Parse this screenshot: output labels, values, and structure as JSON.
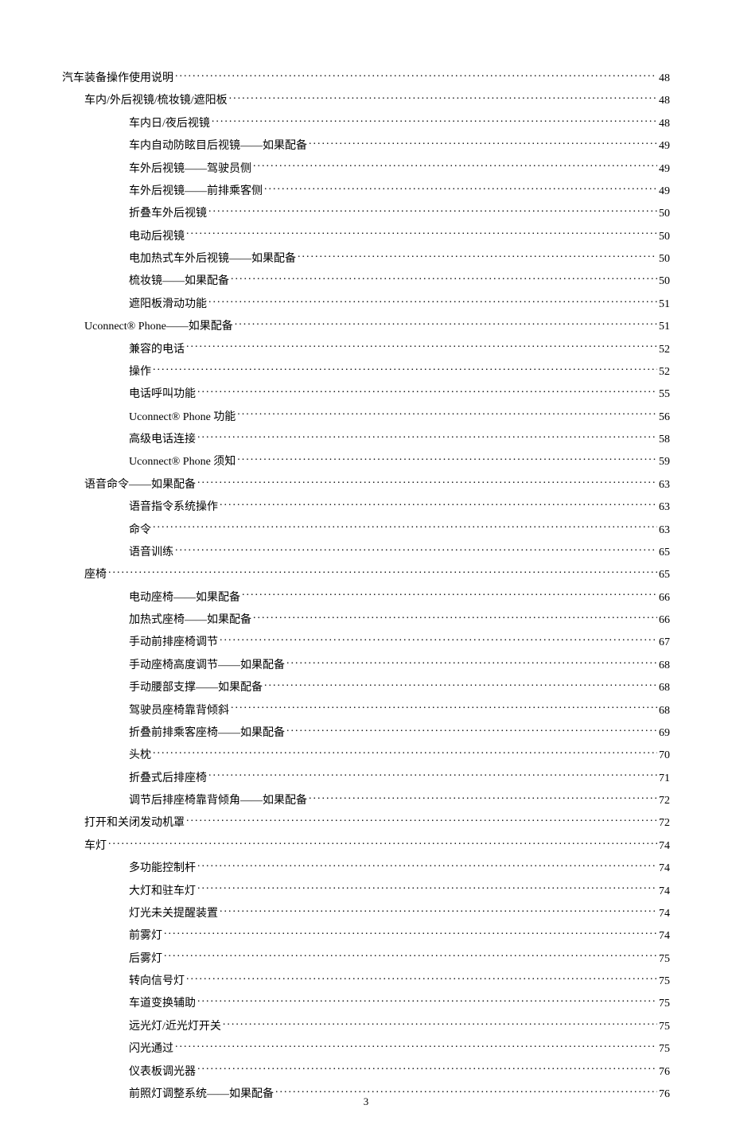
{
  "page_number": "3",
  "toc": [
    {
      "level": 0,
      "title": "汽车装备操作使用说明",
      "page": "48"
    },
    {
      "level": 1,
      "title": "车内/外后视镜/梳妆镜/遮阳板",
      "page": "48"
    },
    {
      "level": 2,
      "title": "车内日/夜后视镜",
      "page": "48"
    },
    {
      "level": 2,
      "title": "车内自动防眩目后视镜——如果配备",
      "page": "49"
    },
    {
      "level": 2,
      "title": "车外后视镜——驾驶员侧",
      "page": "49"
    },
    {
      "level": 2,
      "title": "车外后视镜——前排乘客侧",
      "page": "49"
    },
    {
      "level": 2,
      "title": "折叠车外后视镜",
      "page": "50"
    },
    {
      "level": 2,
      "title": "电动后视镜",
      "page": "50"
    },
    {
      "level": 2,
      "title": "电加热式车外后视镜——如果配备",
      "page": "50"
    },
    {
      "level": 2,
      "title": "梳妆镜——如果配备",
      "page": "50"
    },
    {
      "level": 2,
      "title": "遮阳板滑动功能",
      "page": "51"
    },
    {
      "level": 1,
      "title": "Uconnect® Phone——如果配备",
      "page": "51"
    },
    {
      "level": 2,
      "title": "兼容的电话",
      "page": "52"
    },
    {
      "level": 2,
      "title": "操作",
      "page": "52"
    },
    {
      "level": 2,
      "title": "电话呼叫功能",
      "page": "55"
    },
    {
      "level": 2,
      "title": "Uconnect® Phone 功能",
      "page": "56"
    },
    {
      "level": 2,
      "title": "高级电话连接",
      "page": "58"
    },
    {
      "level": 2,
      "title": "Uconnect® Phone 须知",
      "page": "59"
    },
    {
      "level": 1,
      "title": "语音命令——如果配备",
      "page": "63"
    },
    {
      "level": 2,
      "title": "语音指令系统操作",
      "page": "63"
    },
    {
      "level": 2,
      "title": "命令",
      "page": "63"
    },
    {
      "level": 2,
      "title": "语音训练",
      "page": "65"
    },
    {
      "level": 1,
      "title": "座椅",
      "page": "65"
    },
    {
      "level": 2,
      "title": "电动座椅——如果配备",
      "page": "66"
    },
    {
      "level": 2,
      "title": "加热式座椅——如果配备",
      "page": "66"
    },
    {
      "level": 2,
      "title": "手动前排座椅调节",
      "page": "67"
    },
    {
      "level": 2,
      "title": "手动座椅高度调节——如果配备",
      "page": "68"
    },
    {
      "level": 2,
      "title": "手动腰部支撑——如果配备",
      "page": "68"
    },
    {
      "level": 2,
      "title": "驾驶员座椅靠背倾斜",
      "page": "68"
    },
    {
      "level": 2,
      "title": "折叠前排乘客座椅——如果配备",
      "page": "69"
    },
    {
      "level": 2,
      "title": "头枕",
      "page": "70"
    },
    {
      "level": 2,
      "title": "折叠式后排座椅",
      "page": "71"
    },
    {
      "level": 2,
      "title": "调节后排座椅靠背倾角——如果配备",
      "page": "72"
    },
    {
      "level": 1,
      "title": "打开和关闭发动机罩",
      "page": "72"
    },
    {
      "level": 1,
      "title": "车灯",
      "page": "74"
    },
    {
      "level": 2,
      "title": "多功能控制杆",
      "page": "74"
    },
    {
      "level": 2,
      "title": "大灯和驻车灯",
      "page": "74"
    },
    {
      "level": 2,
      "title": "灯光未关提醒装置",
      "page": "74"
    },
    {
      "level": 2,
      "title": "前雾灯",
      "page": "74"
    },
    {
      "level": 2,
      "title": "后雾灯",
      "page": "75"
    },
    {
      "level": 2,
      "title": "转向信号灯",
      "page": "75"
    },
    {
      "level": 2,
      "title": "车道变换辅助",
      "page": "75"
    },
    {
      "level": 2,
      "title": "远光灯/近光灯开关",
      "page": "75"
    },
    {
      "level": 2,
      "title": "闪光通过",
      "page": "75"
    },
    {
      "level": 2,
      "title": "仪表板调光器",
      "page": "76"
    },
    {
      "level": 2,
      "title": "前照灯调整系统——如果配备",
      "page": "76"
    }
  ]
}
